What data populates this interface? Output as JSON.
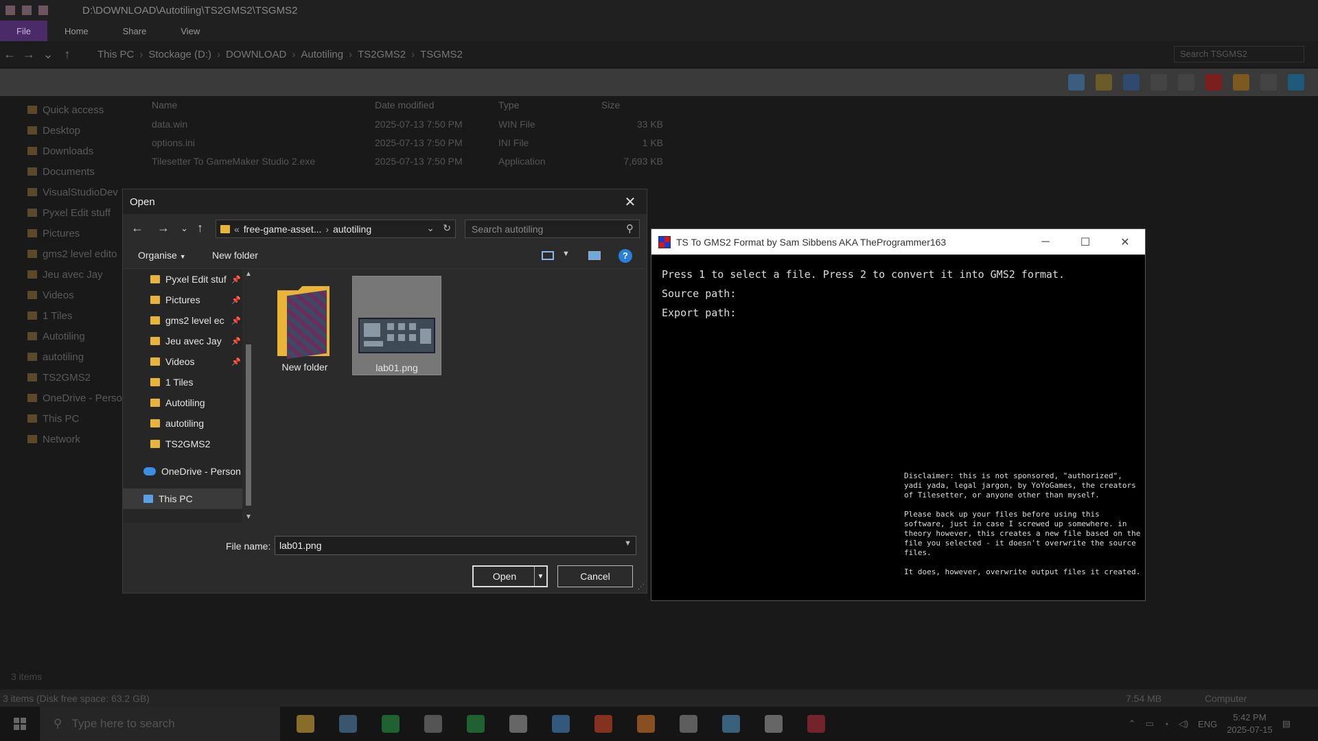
{
  "explorer": {
    "title_path": "D:\\DOWNLOAD\\Autotiling\\TS2GMS2\\TSGMS2",
    "ribbon_tabs": [
      "File",
      "Home",
      "Share",
      "View"
    ],
    "breadcrumbs": [
      "This PC",
      "Stockage (D:)",
      "DOWNLOAD",
      "Autotiling",
      "TS2GMS2",
      "TSGMS2"
    ],
    "search_placeholder": "Search TSGMS2",
    "nav_items": [
      "Quick access",
      "Desktop",
      "Downloads",
      "Documents",
      "VisualStudioDev",
      "Pyxel Edit stuff",
      "Pictures",
      "gms2 level edito",
      "Jeu avec Jay",
      "Videos",
      "1 Tiles",
      "Autotiling",
      "autotiling",
      "TS2GMS2",
      "OneDrive - Persona",
      "This PC",
      "Network"
    ],
    "columns": [
      "Name",
      "Date modified",
      "Type",
      "Size"
    ],
    "files": [
      {
        "name": "data.win",
        "date": "2025-07-13 7:50 PM",
        "type": "WIN File",
        "size": "33 KB"
      },
      {
        "name": "options.ini",
        "date": "2025-07-13 7:50 PM",
        "type": "INI File",
        "size": "1 KB"
      },
      {
        "name": "Tilesetter To GameMaker Studio 2.exe",
        "date": "2025-07-13 7:50 PM",
        "type": "Application",
        "size": "7,693 KB"
      }
    ],
    "items_count": "3 items",
    "status_text": "3 items (Disk free space: 63.2 GB)",
    "status_size": "7.54 MB",
    "status_location": "Computer"
  },
  "open_dialog": {
    "title": "Open",
    "address": {
      "prefix": "«",
      "segment1": "free-game-asset...",
      "segment2": "autotiling"
    },
    "search_placeholder": "Search autotiling",
    "organise_label": "Organise",
    "new_folder_label": "New folder",
    "help_label": "?",
    "nav": [
      {
        "label": "Pyxel Edit stuf",
        "pinned": true
      },
      {
        "label": "Pictures",
        "pinned": true
      },
      {
        "label": "gms2 level ec",
        "pinned": true
      },
      {
        "label": "Jeu avec Jay",
        "pinned": true
      },
      {
        "label": "Videos",
        "pinned": true
      },
      {
        "label": "1 Tiles",
        "pinned": false
      },
      {
        "label": "Autotiling",
        "pinned": false
      },
      {
        "label": "autotiling",
        "pinned": false
      },
      {
        "label": "TS2GMS2",
        "pinned": false
      }
    ],
    "onedrive_label": "OneDrive - Person",
    "thispc_label": "This PC",
    "items": [
      {
        "name": "New folder",
        "kind": "folder"
      },
      {
        "name": "lab01.png",
        "kind": "image",
        "selected": true
      }
    ],
    "file_name_label": "File name:",
    "file_name_value": "lab01.png",
    "open_label": "Open",
    "cancel_label": "Cancel"
  },
  "console": {
    "title": "TS To GMS2 Format by Sam Sibbens AKA TheProgrammer163",
    "line1": "Press 1 to select a file. Press 2 to convert it into GMS2 format.",
    "line2": "Source path:",
    "line3": "Export path:",
    "disclaimer": "Disclaimer: this is not sponsored, \"authorized\", yadi yada, legal jargon, by YoYoGames, the creators of Tilesetter, or anyone other than myself.\n\nPlease back up your files before using this software, just in case I screwed up somewhere. in theory however, this creates a new file based on the file you selected - it doesn't overwrite the source files.\n\nIt does, however, overwrite output files it created."
  },
  "taskbar": {
    "search_placeholder": "Type here to search",
    "language": "ENG",
    "time": "5:42 PM",
    "date": "2025-07-15",
    "app_colors": [
      "#e8b53a",
      "#5a8ab8",
      "#2aa048",
      "#888888",
      "#2aa048",
      "#aaaaaa",
      "#4a90d0",
      "#e04a2a",
      "#e8802a",
      "#999999",
      "#5aa0d0",
      "#aaaaaa",
      "#c03040"
    ]
  }
}
